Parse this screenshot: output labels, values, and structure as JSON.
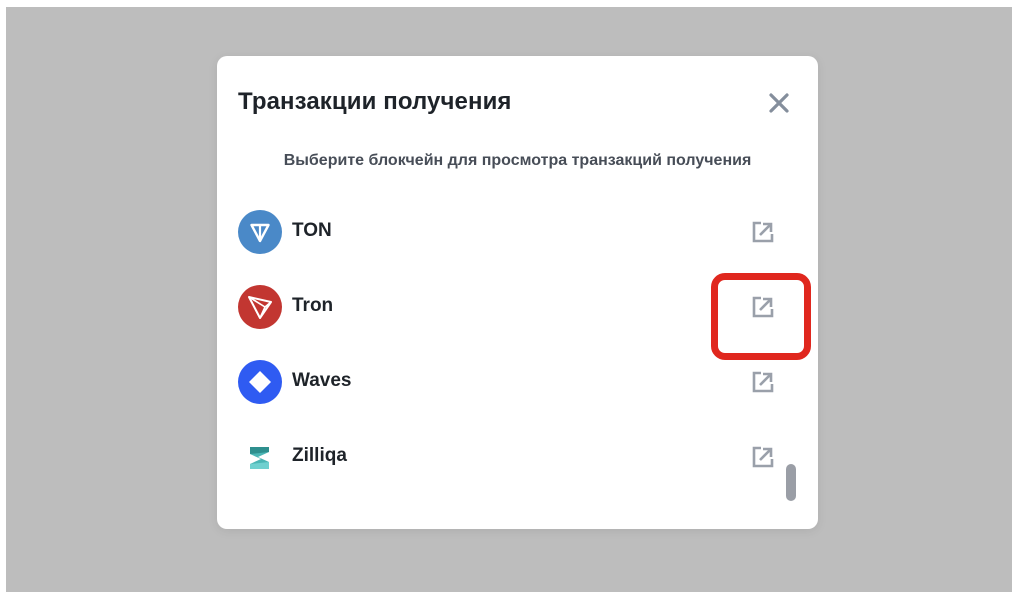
{
  "modal": {
    "title": "Транзакции получения",
    "subtitle": "Выберите блокчейн для просмотра транзакций получения",
    "close_icon": "close-icon"
  },
  "blockchains": [
    {
      "label": "TON",
      "icon": "ton-logo-icon",
      "color": "#4a89c8"
    },
    {
      "label": "Tron",
      "icon": "tron-logo-icon",
      "color": "#c23631"
    },
    {
      "label": "Waves",
      "icon": "waves-logo-icon",
      "color": "#2f5bf2"
    },
    {
      "label": "Zilliqa",
      "icon": "zilliqa-logo-icon",
      "color": "#4bb6b5"
    }
  ],
  "external_link_icon": "external-link-icon",
  "highlight_color": "#e0271e"
}
